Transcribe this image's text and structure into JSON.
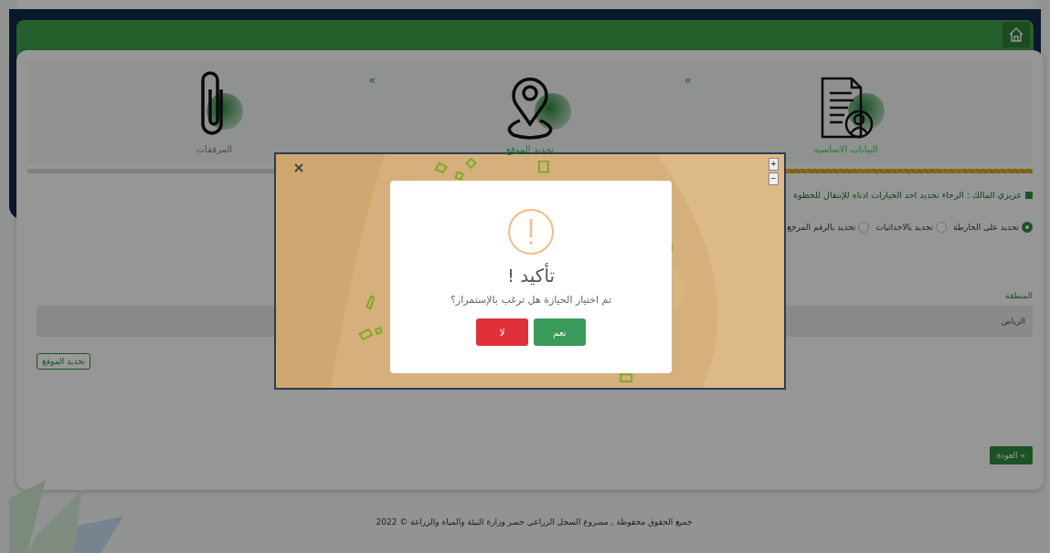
{
  "steps": [
    {
      "label": "البيانات الاساسية",
      "active": true
    },
    {
      "label": "تحديد الموقع",
      "active": true
    },
    {
      "label": "المرفقات",
      "active": false
    }
  ],
  "step_separators": [
    "«",
    "«"
  ],
  "progress": {
    "level": 0.25
  },
  "instruction": "عزيزي المالك : الرجاء تحديد احد الخيارات ادناه للإنتقال للخطوة",
  "options": [
    {
      "label": "تحديد على الخارطة",
      "selected": true
    },
    {
      "label": "تحديد بالاحداثيات",
      "selected": false
    },
    {
      "label": "تحديد بالرقم المرجع",
      "selected": false
    }
  ],
  "region": {
    "label": "المنطقة",
    "value": "الرياض"
  },
  "locate_button": "تحديد الموقع",
  "back_button": {
    "icon": "»",
    "label": "العودة"
  },
  "footer": "جميع الحقوق محفوظة , مشروع السجل الزراعي حصر وزارة البيئة والمياه والزراعة © 2022",
  "map": {
    "zoom_in": "+",
    "zoom_out": "−"
  },
  "modal": {
    "title": "تأكيد !",
    "message": "تم اختيار الحيازة هل ترغب بالإستمرار؟",
    "buttons": [
      {
        "label": "نعم",
        "kind": "confirm"
      },
      {
        "label": "لا",
        "kind": "cancel"
      }
    ]
  }
}
